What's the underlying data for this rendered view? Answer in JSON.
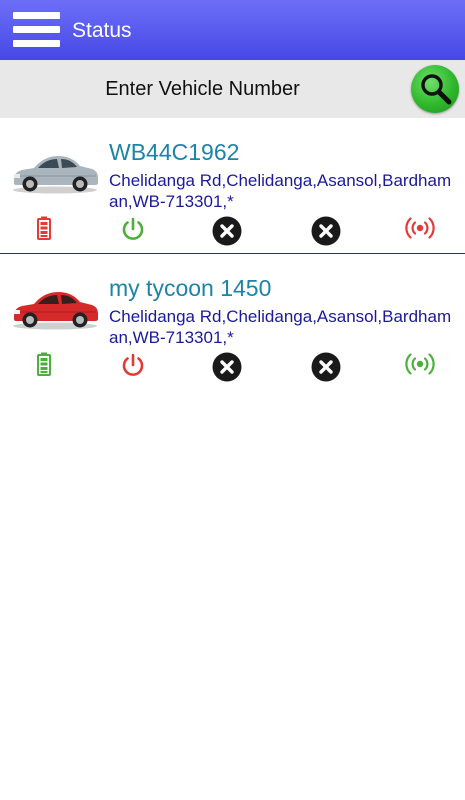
{
  "header": {
    "title": "Status",
    "menu_icon": "hamburger-menu-icon",
    "bg_color": "#5557ee"
  },
  "search": {
    "placeholder": "Enter Vehicle Number",
    "button_icon": "search-icon",
    "button_color": "#2fb82c"
  },
  "vehicles": [
    {
      "name": "WB44C1962",
      "address": "Chelidanga Rd,Chelidanga,Asansol,Bardhaman,WB-713301,*",
      "car_icon": "silver-car-icon",
      "car_color": "#a9b4bd",
      "battery_status": "battery-low",
      "battery_color": "#e53935",
      "ignition_status": "power-on",
      "ignition_color": "#4caf3a",
      "status_3": "x-icon",
      "status_4": "x-icon",
      "signal_status": "signal",
      "signal_color": "#e53935"
    },
    {
      "name": "my tycoon 1450",
      "address": "Chelidanga Rd,Chelidanga,Asansol,Bardhaman,WB-713301,*",
      "car_icon": "red-car-icon",
      "car_color": "#d62a2a",
      "battery_status": "battery-full",
      "battery_color": "#4caf3a",
      "ignition_status": "power-off",
      "ignition_color": "#e53935",
      "status_3": "x-icon",
      "status_4": "x-icon",
      "signal_status": "signal",
      "signal_color": "#4caf3a"
    }
  ]
}
